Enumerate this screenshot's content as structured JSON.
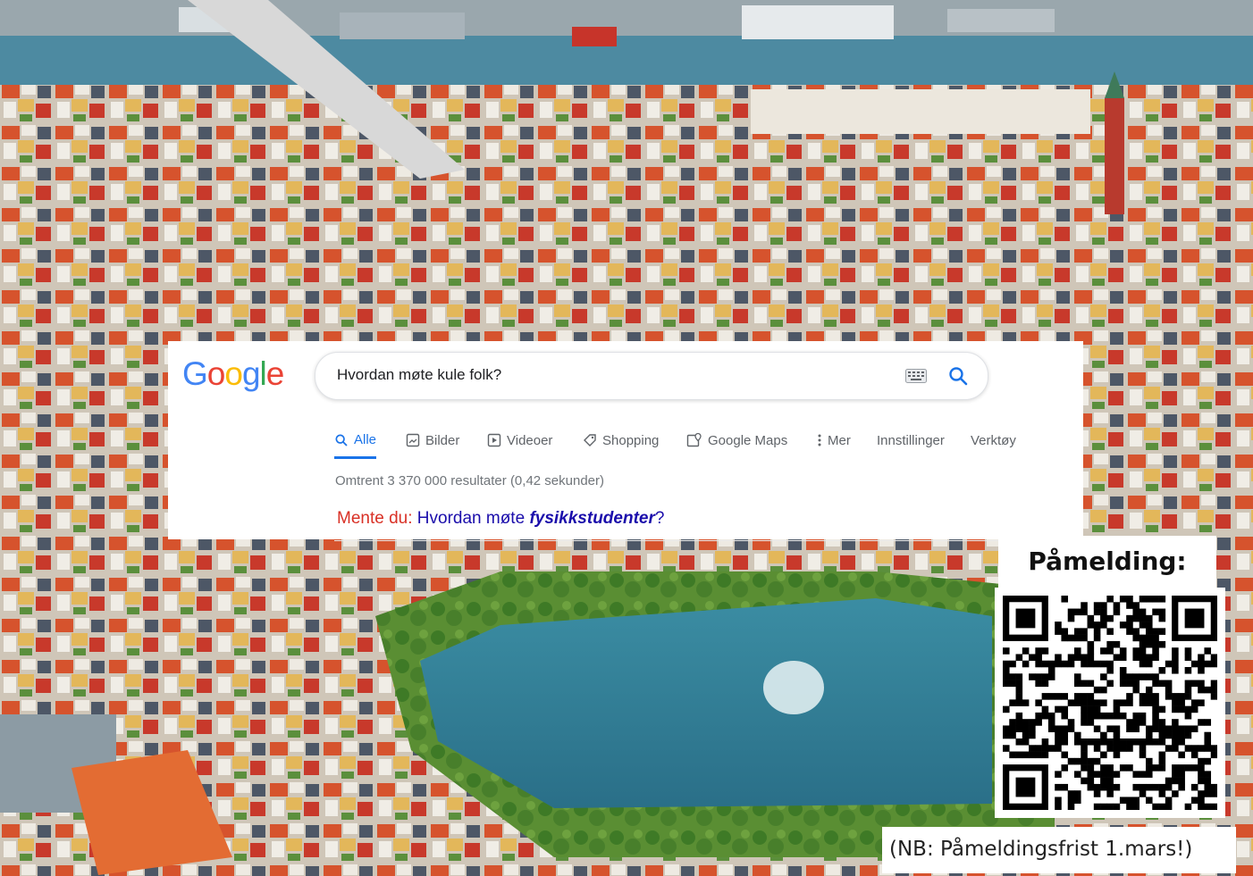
{
  "google": {
    "logo": "Google",
    "logo_letters": [
      {
        "ch": "G",
        "color": "#4285F4"
      },
      {
        "ch": "o",
        "color": "#EA4335"
      },
      {
        "ch": "o",
        "color": "#FBBC05"
      },
      {
        "ch": "g",
        "color": "#4285F4"
      },
      {
        "ch": "l",
        "color": "#34A853"
      },
      {
        "ch": "e",
        "color": "#EA4335"
      }
    ],
    "search_query": "Hvordan møte kule folk?",
    "tabs": [
      {
        "label": "Alle",
        "icon": "search-icon",
        "active": true
      },
      {
        "label": "Bilder",
        "icon": "image-icon",
        "active": false
      },
      {
        "label": "Videoer",
        "icon": "video-icon",
        "active": false
      },
      {
        "label": "Shopping",
        "icon": "tag-icon",
        "active": false
      },
      {
        "label": "Google Maps",
        "icon": "map-icon",
        "active": false
      },
      {
        "label": "Mer",
        "icon": "more-vert-icon",
        "active": false
      },
      {
        "label": "Innstillinger",
        "active": false
      },
      {
        "label": "Verktøy",
        "active": false
      }
    ],
    "result_stats": "Omtrent 3 370 000 resultater (0,42 sekunder)",
    "did_you_mean": {
      "prefix": "Mente du:",
      "text_before": "Hvordan møte ",
      "emphasis": "fysikkstudenter",
      "text_after": "?"
    },
    "accent_color": "#1a73e8",
    "link_color": "#1a0dab"
  },
  "registration": {
    "title": "Påmelding:",
    "deadline": "(NB: Påmeldingsfrist 1.mars!)"
  }
}
